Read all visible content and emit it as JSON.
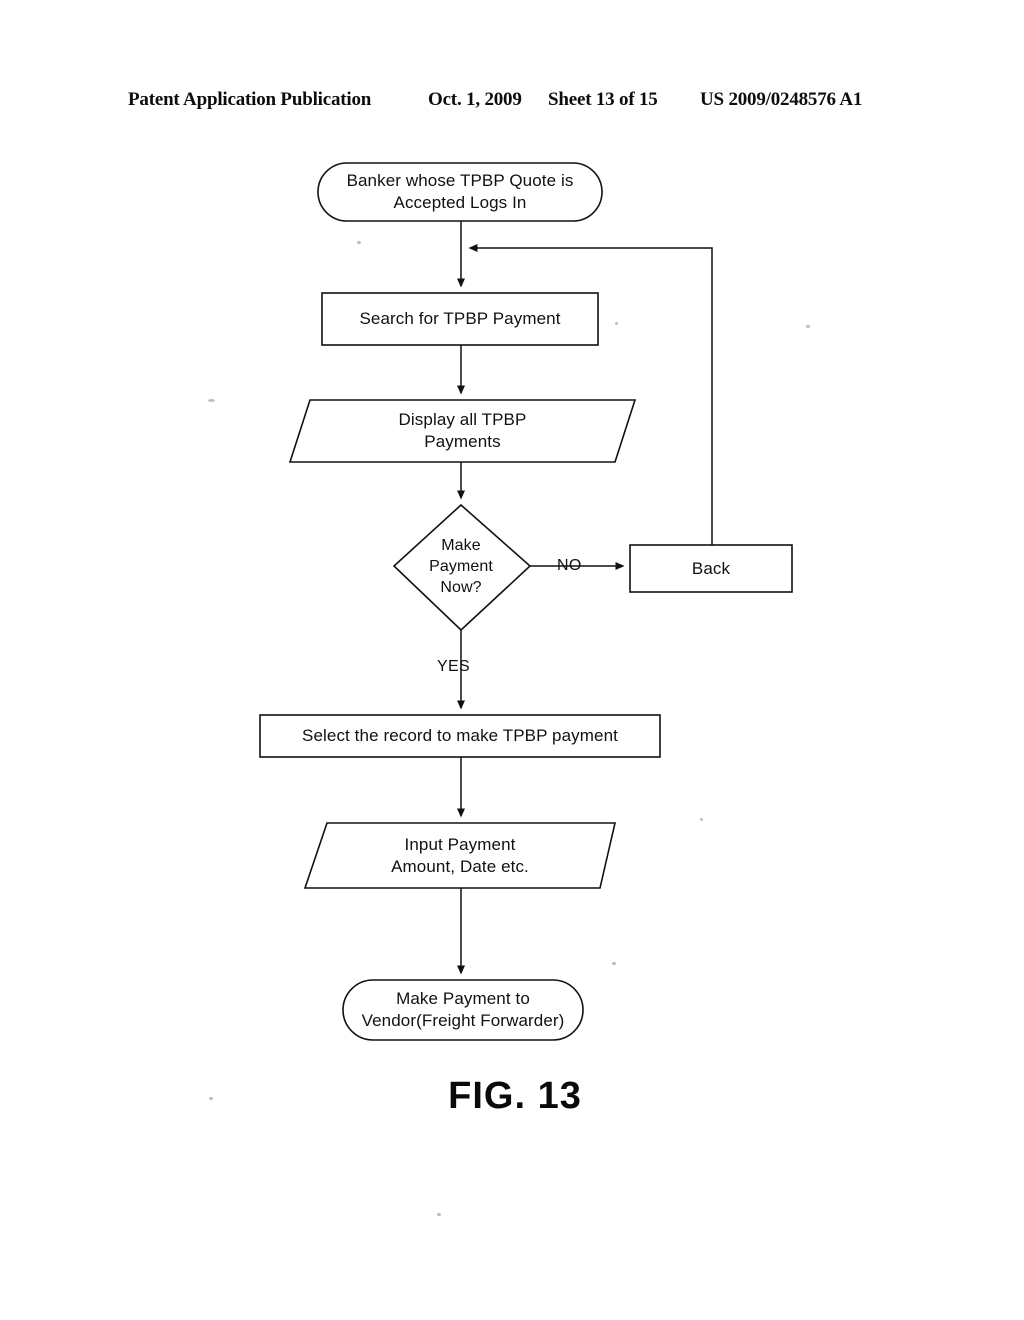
{
  "header": {
    "publication": "Patent Application Publication",
    "date": "Oct. 1, 2009",
    "sheet": "Sheet 13 of 15",
    "patent_number": "US 2009/0248576 A1"
  },
  "figure": {
    "caption": "FIG. 13",
    "stroke_color": "#111111",
    "background_color": "#ffffff"
  },
  "flowchart": {
    "type": "flowchart",
    "title": "FIG. 13",
    "nodes": [
      {
        "id": "start",
        "shape": "terminator",
        "label": "Banker whose TPBP Quote is\nAccepted Logs In"
      },
      {
        "id": "search",
        "shape": "process",
        "label": "Search for TPBP Payment"
      },
      {
        "id": "display",
        "shape": "data",
        "label": "Display all TPBP\nPayments"
      },
      {
        "id": "decision",
        "shape": "decision",
        "label": "Make\nPayment\nNow?"
      },
      {
        "id": "back",
        "shape": "process",
        "label": "Back"
      },
      {
        "id": "select",
        "shape": "process",
        "label": "Select the record to make TPBP payment"
      },
      {
        "id": "input",
        "shape": "data",
        "label": "Input Payment\nAmount, Date etc."
      },
      {
        "id": "end",
        "shape": "terminator",
        "label": "Make Payment to\nVendor(Freight Forwarder)"
      }
    ],
    "edges": [
      {
        "from": "start",
        "to": "search",
        "label": ""
      },
      {
        "from": "search",
        "to": "display",
        "label": ""
      },
      {
        "from": "display",
        "to": "decision",
        "label": ""
      },
      {
        "from": "decision",
        "to": "back",
        "label": "NO"
      },
      {
        "from": "decision",
        "to": "select",
        "label": "YES"
      },
      {
        "from": "back",
        "to": "search",
        "label": ""
      },
      {
        "from": "select",
        "to": "input",
        "label": ""
      },
      {
        "from": "input",
        "to": "end",
        "label": ""
      }
    ],
    "edge_labels": {
      "no": "NO",
      "yes": "YES"
    }
  }
}
